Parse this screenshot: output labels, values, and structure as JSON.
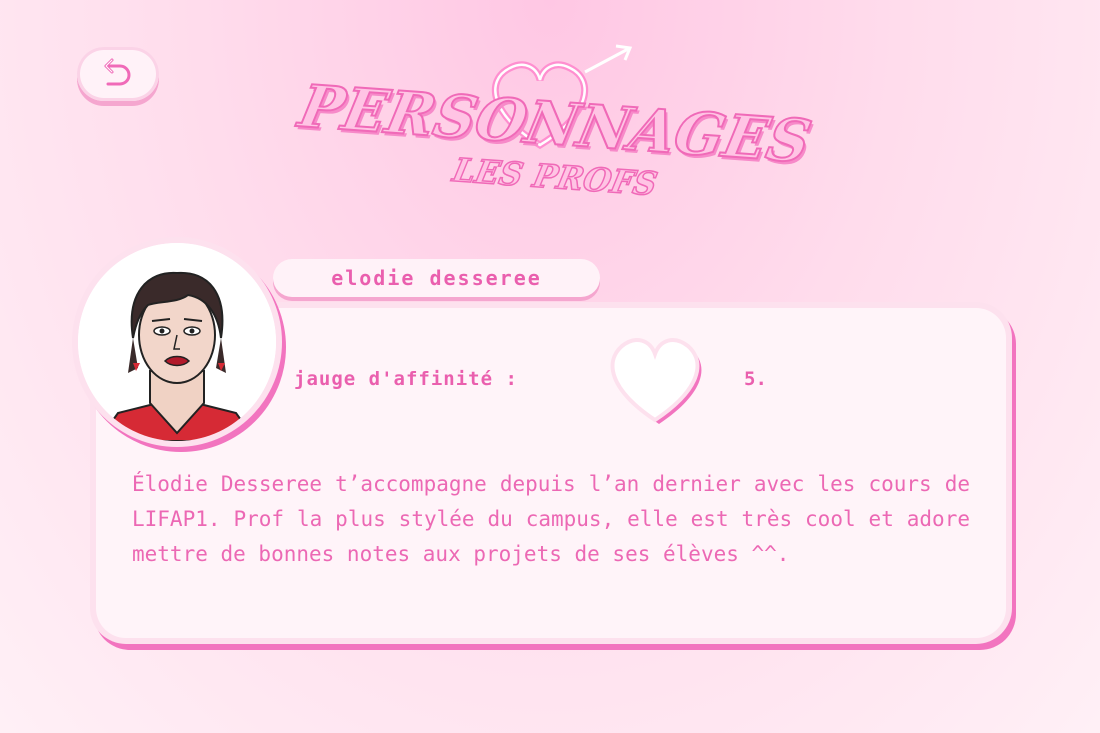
{
  "header": {
    "title": "PERSONNAGES",
    "subtitle": "LES PROFS"
  },
  "nav": {
    "back_icon": "back-arrow-icon"
  },
  "character": {
    "name": "Elodie desseree",
    "affinity_label": "Jauge d'affinité :",
    "affinity_value": "5.",
    "description": "Élodie Desseree t’accompagne depuis l’an dernier avec les cours de LIFAP1. Prof la plus stylée du campus, elle est très cool et adore mettre de bonnes notes aux projets de ses élèves ^^."
  },
  "colors": {
    "accent": "#ea5fae",
    "card_bg": "#fff4f9",
    "shadow": "#f274bf"
  }
}
